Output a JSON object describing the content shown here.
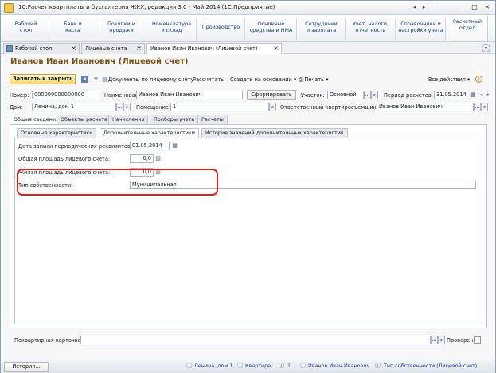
{
  "window": {
    "title": "1С:Расчет квартплаты и бухгалтерия ЖКХ, редакция 3.0 - Май 2014  (1С:Предприятие)",
    "controls": [
      "_",
      "□",
      "×"
    ]
  },
  "sections": [
    {
      "label": "Рабочий\nстол"
    },
    {
      "label": "Банк и\nкасса"
    },
    {
      "label": "Покупки и\nпродажи"
    },
    {
      "label": "Номенклатура\nи склад"
    },
    {
      "label": "Производство"
    },
    {
      "label": "Основные\nсредства и НМА"
    },
    {
      "label": "Сотрудники\nи зарплата"
    },
    {
      "label": "Учет, налоги,\nотчетность"
    },
    {
      "label": "Справочники и\nнастройки учета"
    },
    {
      "label": "Расчетный\nотдел"
    }
  ],
  "tabs": [
    {
      "label": "Рабочий стол"
    },
    {
      "label": "Лицевые счета"
    },
    {
      "label": "Иванов Иван Иванович (Лицевой счет)"
    }
  ],
  "form": {
    "title": "Иванов Иван Иванович (Лицевой счет)",
    "toolbar": {
      "save_close": "Записать и закрыть",
      "documents": "Документы по лицевому счету",
      "calculate": "Рассчитать",
      "create_based": "Создать на основании",
      "print": "Печать",
      "all_actions": "Все действия"
    },
    "fields": {
      "number_label": "Номер:",
      "number_value": "000000000000000",
      "name_label": "Наименование:",
      "name_value": "Иванов Иван Иванович",
      "form_button": "Сформировать",
      "area_label": "Участок:",
      "area_value": "Основной",
      "period_label": "Период расчетов:",
      "period_value": "31.05.2014",
      "house_label": "Дом:",
      "house_value": "Ленина, дом 1",
      "room_label": "Помещение:",
      "room_value": "1",
      "tenant_label": "Ответственный квартиросъемщик:",
      "tenant_value": "Иванов Иван Иванович"
    },
    "main_tabs": [
      {
        "label": "Общие сведения"
      },
      {
        "label": "Объекты расчета"
      },
      {
        "label": "Начисления"
      },
      {
        "label": "Приборы учета"
      },
      {
        "label": "Расчеты"
      }
    ],
    "sub_tabs": [
      {
        "label": "Основные характеристики"
      },
      {
        "label": "Дополнительные характеристики"
      },
      {
        "label": "История  значений дополнительных характеристик"
      }
    ],
    "details": {
      "date_label": "Дата записи периодических реквизитов:",
      "date_value": "01.05.2014",
      "total_area_label": "Общая площадь лицевого счета:",
      "total_area_value": "0,0",
      "living_area_label": "Жилая площадь лицевого счета:",
      "living_area_value": "0,0",
      "ownership_label": "Тип собственности:",
      "ownership_value": "Муниципальная"
    },
    "bottom": {
      "card_label": "Поквартирная карточка:",
      "card_value": "",
      "checked_label": "Проверен:"
    }
  },
  "status": {
    "history_button": "История...",
    "items": [
      "Ленина, дом 1",
      "Квартира",
      "1",
      "Иванов Иван Иванович",
      "Тип собственности (Лицевой счет)"
    ]
  }
}
